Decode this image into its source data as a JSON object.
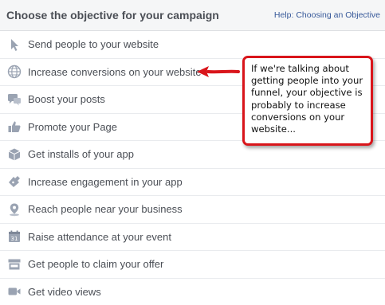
{
  "header": {
    "title": "Choose the objective for your campaign",
    "help_link": "Help: Choosing an Objective"
  },
  "objectives": [
    {
      "label": "Send people to your website",
      "icon": "cursor-icon"
    },
    {
      "label": "Increase conversions on your website",
      "icon": "globe-icon"
    },
    {
      "label": "Boost your posts",
      "icon": "speech-bubbles-icon"
    },
    {
      "label": "Promote your Page",
      "icon": "thumbs-up-icon"
    },
    {
      "label": "Get installs of your app",
      "icon": "box-icon"
    },
    {
      "label": "Increase engagement in your app",
      "icon": "controller-icon"
    },
    {
      "label": "Reach people near your business",
      "icon": "map-pin-icon"
    },
    {
      "label": "Raise attendance at your event",
      "icon": "calendar-icon"
    },
    {
      "label": "Get people to claim your offer",
      "icon": "storefront-icon"
    },
    {
      "label": "Get video views",
      "icon": "video-camera-icon"
    }
  ],
  "annotation": {
    "text": "If we're talking about getting people into your funnel, your objective is probably to increase conversions on your website...",
    "border_color": "#d9151b"
  },
  "colors": {
    "icon": "#9aa3b2",
    "text": "#4b4f56",
    "link": "#365899"
  }
}
